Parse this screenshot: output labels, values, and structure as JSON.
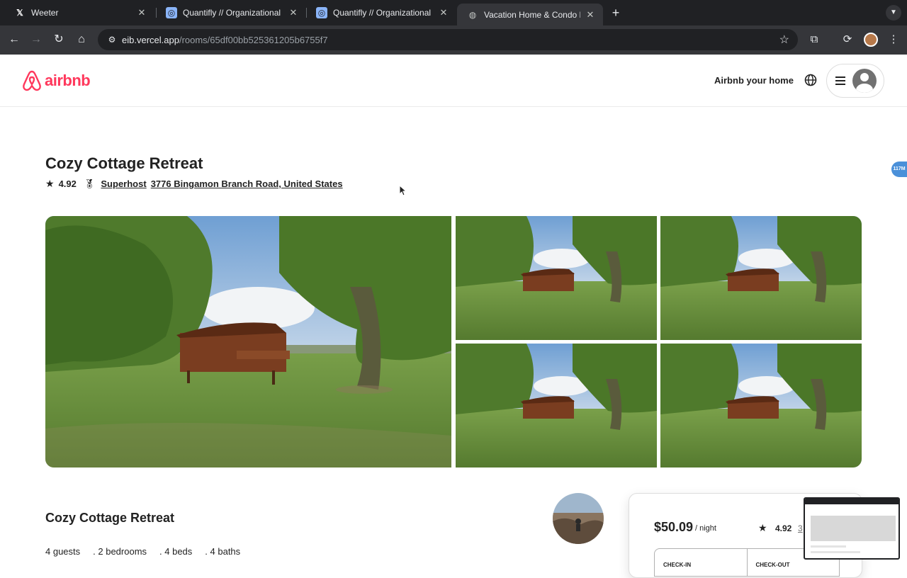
{
  "browser": {
    "tabs": [
      {
        "title": "Weeter",
        "icon": "x-logo-icon"
      },
      {
        "title": "Quantifly // Organizational Dia",
        "icon": "quantifly-icon"
      },
      {
        "title": "Quantifly // Organizational Dia",
        "icon": "quantifly-icon"
      },
      {
        "title": "Vacation Home & Condo Rent",
        "icon": "globe-icon",
        "active": true
      }
    ],
    "url_host": "eib.vercel.app",
    "url_path": "/rooms/65df00bb525361205b6755f7"
  },
  "header": {
    "brand": "airbnb",
    "host_link": "Airbnb your home"
  },
  "listing": {
    "title": "Cozy Cottage Retreat",
    "rating": "4.92",
    "superhost": "Superhost",
    "address": "3776 Bingamon Branch Road, United States"
  },
  "extension_badge": "117M",
  "details": {
    "title": "Cozy Cottage Retreat",
    "guests": "4 guests",
    "bedrooms": ". 2 bedrooms",
    "beds": ". 4 beds",
    "baths": ". 4 baths"
  },
  "booking": {
    "price": "$50.09",
    "per_night": "/ night",
    "rating": "4.92",
    "reviews": "3",
    "check_in": "CHECK-IN",
    "check_out": "CHECK-OUT"
  },
  "colors": {
    "brand": "#ff385c",
    "chrome_dark": "#202124",
    "chrome_toolbar": "#35363a"
  }
}
